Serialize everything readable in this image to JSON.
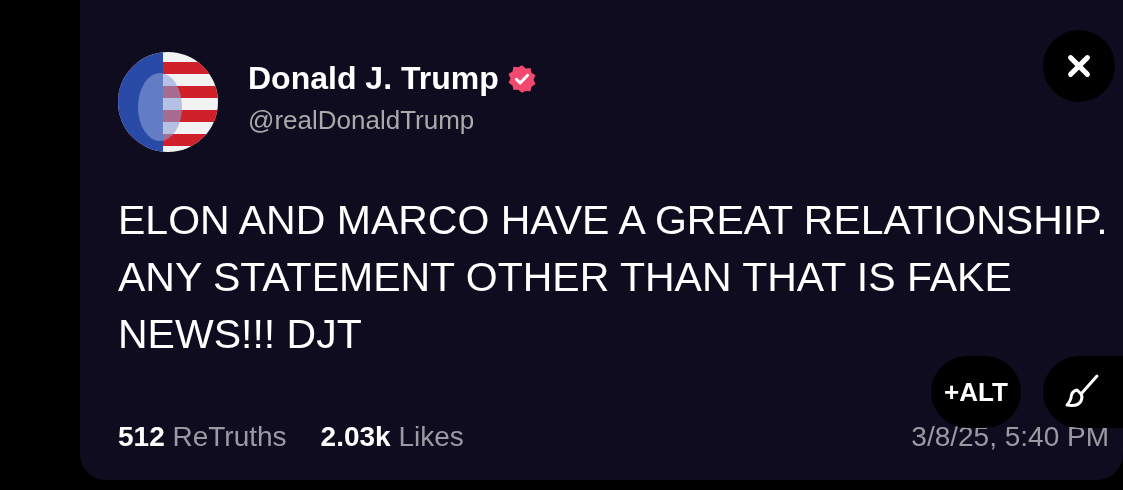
{
  "post": {
    "author": {
      "name": "Donald J. Trump",
      "handle": "@realDonaldTrump",
      "verified": true
    },
    "text": "ELON AND MARCO HAVE A GREAT RELATIONSHIP. ANY STATEMENT OTHER THAN THAT IS FAKE NEWS!!! DJT",
    "stats": [
      {
        "count": "512",
        "label": "ReTruths"
      },
      {
        "count": "2.03k",
        "label": "Likes"
      }
    ],
    "timestamp": "3/8/25, 5:40 PM"
  },
  "overlay": {
    "alt_button": "+ALT"
  }
}
